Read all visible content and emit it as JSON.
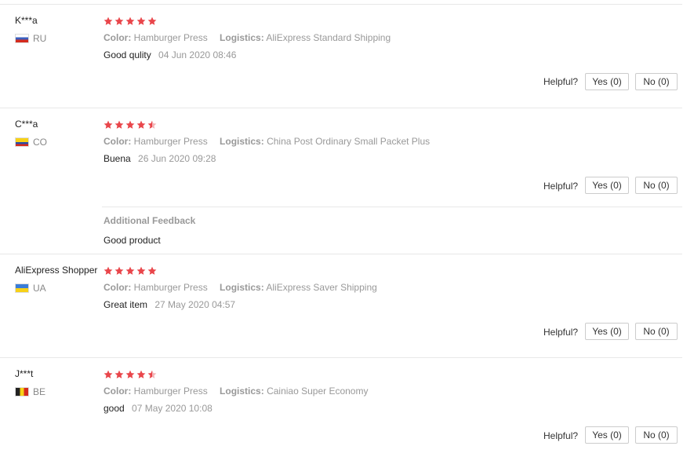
{
  "reviews": [
    {
      "user": "K***a",
      "country": "RU",
      "flag": "russia",
      "rating": 5,
      "color_label": "Color:",
      "color_value": "Hamburger Press",
      "logistics_label": "Logistics:",
      "logistics_value": "AliExpress Standard Shipping",
      "text": "Good qulity",
      "date": "04 Jun 2020 08:46",
      "helpful_label": "Helpful?",
      "yes_label": "Yes (0)",
      "no_label": "No (0)"
    },
    {
      "user": "C***a",
      "country": "CO",
      "flag": "colombia",
      "rating": 4.5,
      "color_label": "Color:",
      "color_value": "Hamburger Press",
      "logistics_label": "Logistics:",
      "logistics_value": "China Post Ordinary Small Packet Plus",
      "text": "Buena",
      "date": "26 Jun 2020 09:28",
      "helpful_label": "Helpful?",
      "yes_label": "Yes (0)",
      "no_label": "No (0)",
      "additional_title": "Additional Feedback",
      "additional_text": "Good product"
    },
    {
      "user": "AliExpress Shopper",
      "country": "UA",
      "flag": "ukraine",
      "rating": 5,
      "color_label": "Color:",
      "color_value": "Hamburger Press",
      "logistics_label": "Logistics:",
      "logistics_value": "AliExpress Saver Shipping",
      "text": "Great item",
      "date": "27 May 2020 04:57",
      "helpful_label": "Helpful?",
      "yes_label": "Yes (0)",
      "no_label": "No (0)"
    },
    {
      "user": "J***t",
      "country": "BE",
      "flag": "belgium",
      "rating": 4.5,
      "color_label": "Color:",
      "color_value": "Hamburger Press",
      "logistics_label": "Logistics:",
      "logistics_value": "Cainiao Super Economy",
      "text": "good",
      "date": "07 May 2020 10:08",
      "helpful_label": "Helpful?",
      "yes_label": "Yes (0)",
      "no_label": "No (0)"
    }
  ],
  "colors": {
    "star": "#e9464b",
    "separator": "#e8e8e8",
    "muted_text": "#999999"
  }
}
